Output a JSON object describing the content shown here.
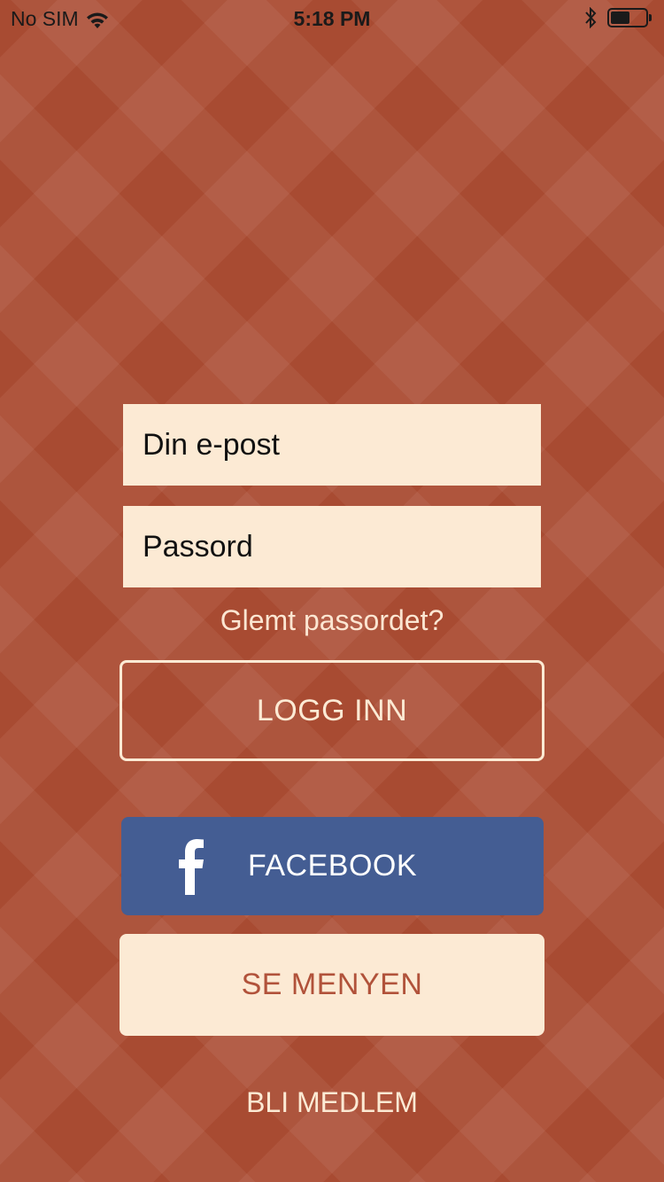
{
  "status_bar": {
    "carrier": "No SIM",
    "time": "5:18 PM",
    "battery_level": 0.6
  },
  "login_form": {
    "email_placeholder": "Din e-post",
    "password_placeholder": "Passord",
    "forgot_password": "Glemt passordet?",
    "login_button": "LOGG INN"
  },
  "social": {
    "facebook_button": "FACEBOOK"
  },
  "actions": {
    "see_menu_button": "SE MENYEN",
    "join_link": "BLI MEDLEM"
  },
  "colors": {
    "background": "#ab4c33",
    "field_background": "#fcead4",
    "facebook_blue": "#445d93",
    "accent_text": "#b1523a"
  },
  "icons": [
    "wifi-icon",
    "bluetooth-icon",
    "battery-icon",
    "facebook-icon"
  ]
}
